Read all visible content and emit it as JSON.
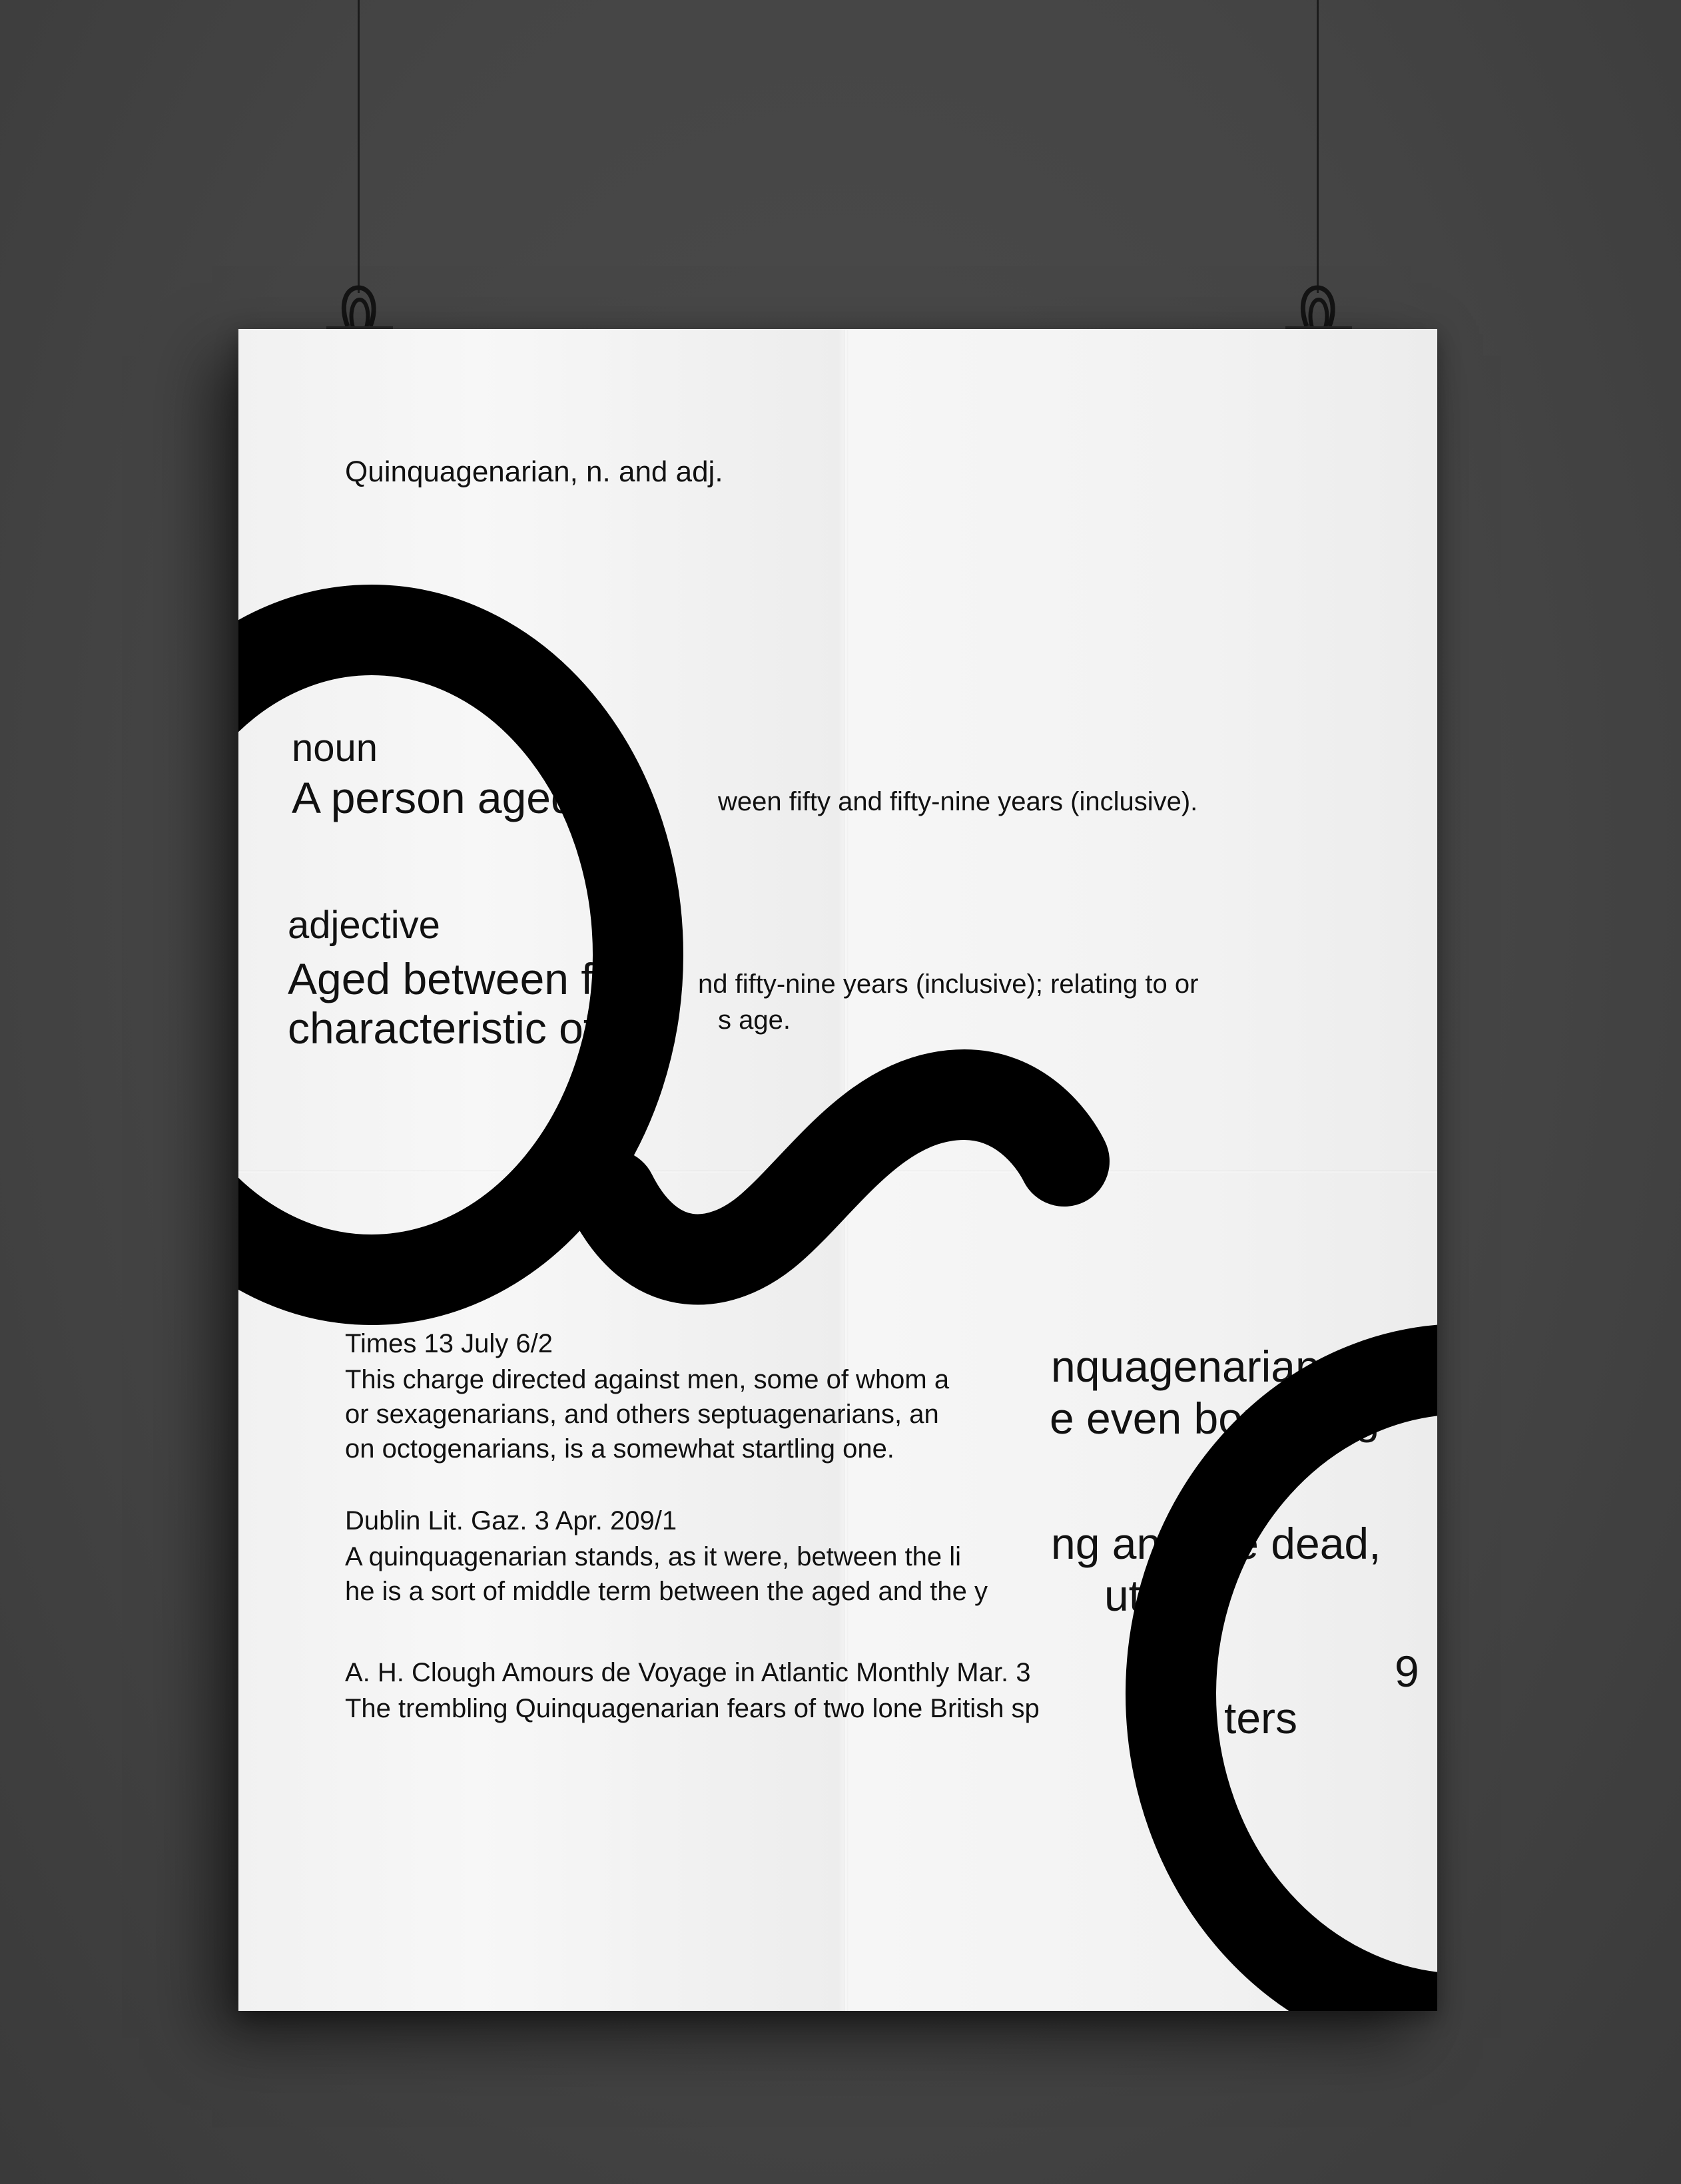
{
  "headword": "Quinquagenarian, n. and adj.",
  "noun": {
    "label": "noun",
    "definition_large": "A person aged b",
    "definition_small": "ween fifty and fifty-nine years (inclusive)."
  },
  "adjective": {
    "label": "adjective",
    "line1_large": "Aged between fifty",
    "line1_small": "nd fifty-nine years (inclusive); relating to or",
    "line2_large": "characteristic of t",
    "line2_small": "s age."
  },
  "quotations": [
    {
      "source": "Times 13 July 6/2",
      "lines": [
        "This charge directed against men, some of whom a",
        "or sexagenarians, and others septuagenarians, an",
        "on octogenarians, is a somewhat startling one."
      ],
      "large_fragments": [
        "nquagenarians",
        "e even bordering"
      ]
    },
    {
      "source": "Dublin Lit. Gaz. 3 Apr. 209/1",
      "lines": [
        "A quinquagenarian stands, as it were, between the li",
        "he is a sort of middle term between the aged and the y"
      ],
      "large_fragments": [
        "ng and the dead,",
        "uthful."
      ]
    },
    {
      "source": "A. H. Clough Amours de Voyage in Atlantic Monthly Mar. 3",
      "source_fragment": "9",
      "lines": [
        "The trembling Quinquagenarian fears of two lone British sp"
      ],
      "large_fragments": [
        "ters"
      ]
    }
  ],
  "colors": {
    "wall": "#454545",
    "paper": "#f2f2f2",
    "ink": "#111111",
    "shape": "#000000"
  },
  "icons": [
    "binder-clip-icon",
    "binder-clip-icon"
  ]
}
